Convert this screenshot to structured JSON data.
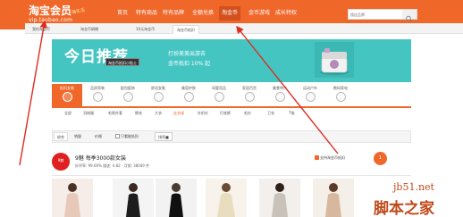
{
  "header": {
    "logo_title": "淘宝会员",
    "logo_tag": "嗨生活",
    "logo_domain": "vip.taobao.com",
    "nav": [
      "首页",
      "特有商品",
      "特有品牌",
      "全额兑换",
      "淘金币",
      "金币游戏",
      "成长特权"
    ],
    "search_placeholder": "搜这品牌",
    "accent_color": "#f0672a"
  },
  "subtabs": [
    "我的淘金币",
    "淘金币捐赠",
    "10元淘金币",
    "淘金币抵扣"
  ],
  "banner": {
    "title": "今日推荐",
    "tooltip": "淘金币抵扣小贴士",
    "promo_line1": "打扮美美出游去",
    "promo_line2": "金币抵扣 10% 起",
    "background_color": "#44c5c2"
  },
  "categories": [
    "抵扣女装",
    "品质男装",
    "配包配饰",
    "舒适女鞋",
    "美容护肤",
    "母婴用品",
    "家居百货",
    "美食特产",
    "运动户外",
    "数码家电"
  ],
  "subcategories": [
    "全部",
    "羽绒服",
    "毛呢外套",
    "棉衣",
    "大衣",
    "连衣裙",
    "针织衫",
    "打底裤",
    "毛衫",
    "卫衣",
    "T恤"
  ],
  "filters": {
    "all": "综合",
    "sales": "销量",
    "price": "价格",
    "free_shipping": "只看能抵扣",
    "sort": "排序■"
  },
  "store": {
    "logo_text": "9魅",
    "name": "9魅 每季3000款女装",
    "stats": "好评率: 99.69%  描述: 4.82  · 月销: 38049 件",
    "support": "支持淘金币抵扣",
    "float_badge": "1"
  },
  "watermark": {
    "domain": "jb51.net",
    "name": "脚本之家"
  }
}
